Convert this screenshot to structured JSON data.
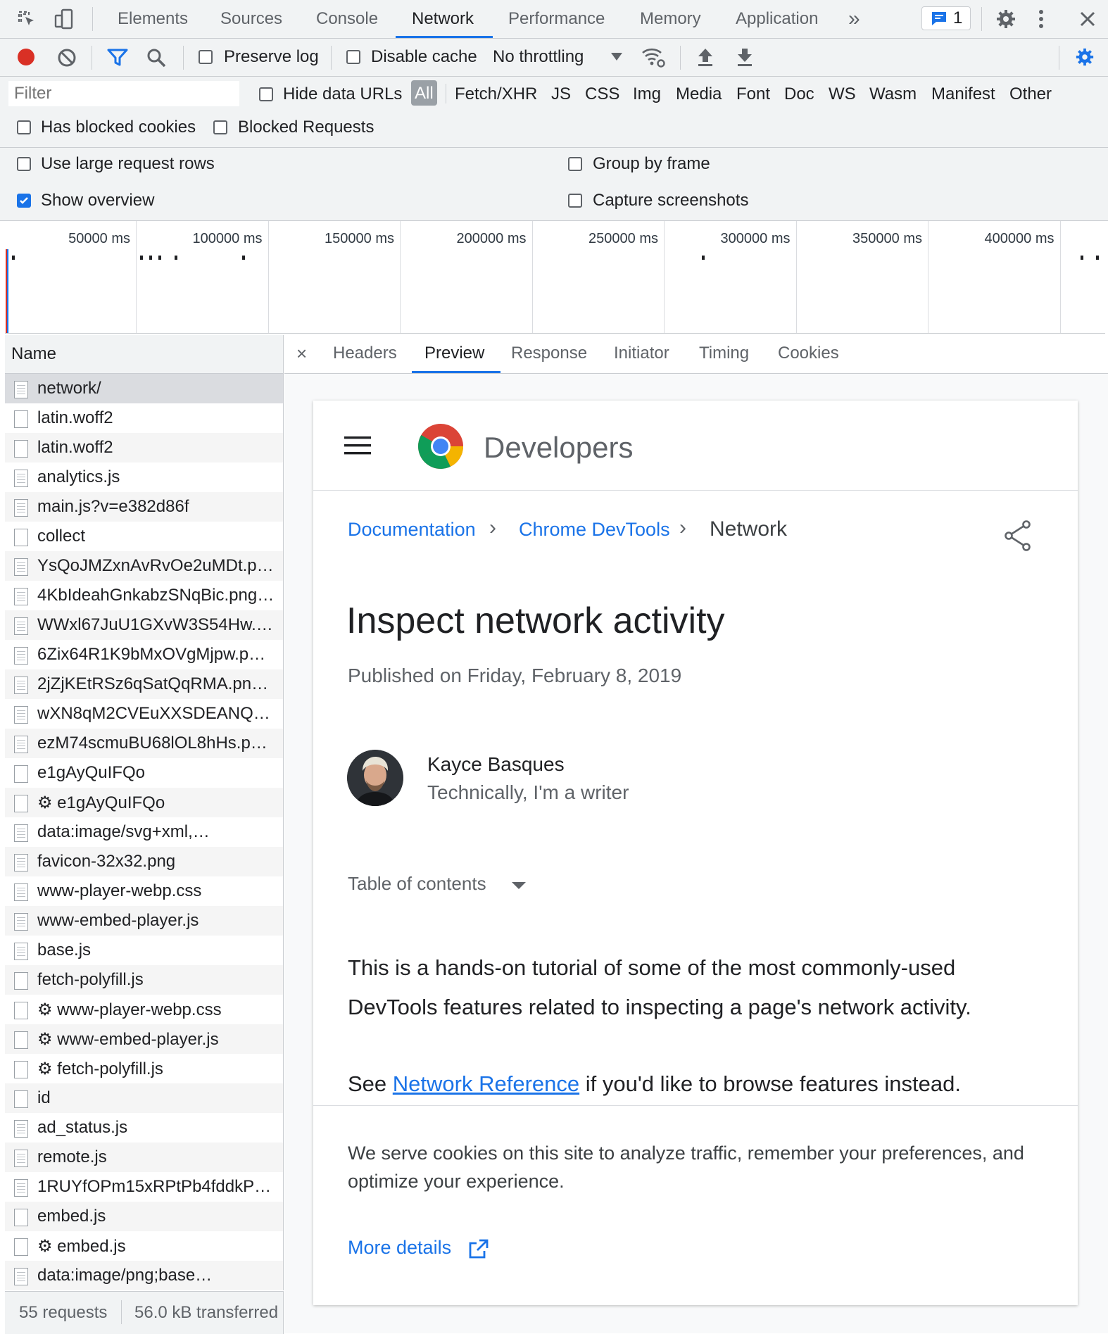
{
  "toolbar": {
    "tabs": [
      "Elements",
      "Sources",
      "Console",
      "Network",
      "Performance",
      "Memory",
      "Application"
    ],
    "active_tab": "Network",
    "more_label": "»",
    "issues_count": "1"
  },
  "controls": {
    "preserve_log": "Preserve log",
    "disable_cache": "Disable cache",
    "throttling": "No throttling"
  },
  "filter": {
    "placeholder": "Filter",
    "hide_data_urls": "Hide data URLs",
    "types": [
      "All",
      "Fetch/XHR",
      "JS",
      "CSS",
      "Img",
      "Media",
      "Font",
      "Doc",
      "WS",
      "Wasm",
      "Manifest",
      "Other"
    ],
    "has_blocked_cookies": "Has blocked cookies",
    "blocked_requests": "Blocked Requests"
  },
  "settings": {
    "use_large_rows": "Use large request rows",
    "group_by_frame": "Group by frame",
    "show_overview": "Show overview",
    "capture_screenshots": "Capture screenshots",
    "show_overview_checked": true
  },
  "overview": {
    "ticks": [
      "50000 ms",
      "100000 ms",
      "150000 ms",
      "200000 ms",
      "250000 ms",
      "300000 ms",
      "350000 ms",
      "400000 ms"
    ]
  },
  "requests": {
    "header": "Name",
    "items": [
      "network/",
      "latin.woff2",
      "latin.woff2",
      "analytics.js",
      "main.js?v=e382d86f",
      "collect",
      "YsQoJMZxnAvRvOe2uMDt.p…",
      "4KbIdeahGnkabzSNqBic.png…",
      "WWxl67JuU1GXvW3S54Hw.…",
      "6Zix64R1K9bMxOVgMjpw.p…",
      "2jZjKEtRSz6qSatQqRMA.pn…",
      "wXN8qM2CVEuXXSDEANQP…",
      "ezM74scmuBU68lOL8hHs.p…",
      "e1gAyQuIFQo",
      "⚙ e1gAyQuIFQo",
      "data:image/svg+xml,…",
      "favicon-32x32.png",
      "www-player-webp.css",
      "www-embed-player.js",
      "base.js",
      "fetch-polyfill.js",
      "⚙ www-player-webp.css",
      "⚙ www-embed-player.js",
      "⚙ fetch-polyfill.js",
      "id",
      "ad_status.js",
      "remote.js",
      "1RUYfOPm15xRPtPb4fddkP…",
      "embed.js",
      "⚙ embed.js",
      "data:image/png;base…"
    ],
    "summary_requests": "55 requests",
    "summary_transferred": "56.0 kB transferred"
  },
  "detail": {
    "close": "×",
    "tabs": [
      "Headers",
      "Preview",
      "Response",
      "Initiator",
      "Timing",
      "Cookies"
    ],
    "active_tab": "Preview"
  },
  "preview": {
    "brand": "Developers",
    "breadcrumb": [
      "Documentation",
      "Chrome DevTools",
      "Network"
    ],
    "title": "Inspect network activity",
    "published": "Published on Friday, February 8, 2019",
    "author_name": "Kayce Basques",
    "author_bio": "Technically, I'm a writer",
    "toc": "Table of contents",
    "intro": "This is a hands-on tutorial of some of the most commonly-used DevTools features related to inspecting a page's network activity.",
    "see_prefix": "See ",
    "see_link": "Network Reference",
    "see_suffix": " if you'd like to browse features instead.",
    "cookie_text": "We serve cookies on this site to analyze traffic, remember your preferences, and optimize your experience.",
    "more_details": "More details"
  },
  "colors": {
    "accent": "#1a73e8",
    "record": "#d93025"
  }
}
